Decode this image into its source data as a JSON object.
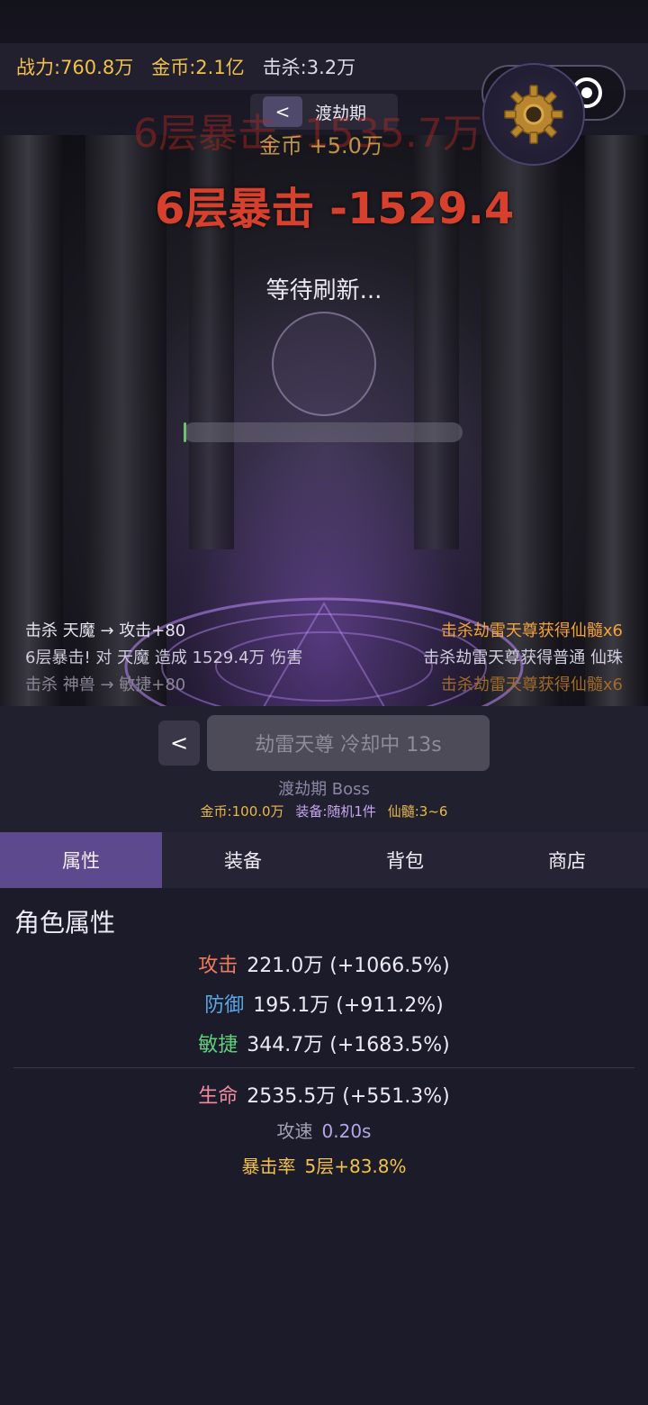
{
  "stats": {
    "power": "战力:760.8万",
    "gold": "金币:2.1亿",
    "kills": "击杀:3.2万"
  },
  "stage": {
    "back_label": "<",
    "name": "渡劫期"
  },
  "battle": {
    "ghost_damage": "6层暴击 -1535.7万",
    "damage_text": "6层暴击 -1529.4万",
    "gold_float": "金币 +5.0万",
    "wait_text": "等待刷新...",
    "progress_fraction": 0.01
  },
  "log": {
    "left": [
      {
        "text": "击杀 天魔 → 攻击+80",
        "color": "#e6e2ee"
      },
      {
        "text": "6层暴击! 对 天魔 造成 1529.4万 伤害",
        "color": "#cfc9dc"
      },
      {
        "text": "击杀 神兽 → 敏捷+80",
        "color": "#8a8596"
      }
    ],
    "right": [
      {
        "text": "击杀劫雷天尊获得仙髓x6",
        "color": "#f2a33a"
      },
      {
        "text": "击杀劫雷天尊获得普通 仙珠",
        "color": "#d3cedf"
      },
      {
        "text": "击杀劫雷天尊获得仙髓x6",
        "color": "#a06a2a"
      }
    ]
  },
  "boss": {
    "back_label": "<",
    "button_label": "劫雷天尊 冷却中 13s",
    "label": "渡劫期 Boss",
    "rewards": {
      "gold": "金币:100.0万",
      "equip": "装备:随机1件",
      "marrow": "仙髓:3~6"
    }
  },
  "tabs": [
    "属性",
    "装备",
    "背包",
    "商店"
  ],
  "active_tab": "属性",
  "attributes": {
    "title": "角色属性",
    "attack": {
      "label": "攻击",
      "value": "221.0万 (+1066.5%)",
      "color": "#f07a5e"
    },
    "defense": {
      "label": "防御",
      "value": "195.1万 (+911.2%)",
      "color": "#5aa8e6"
    },
    "agility": {
      "label": "敏捷",
      "value": "344.7万 (+1683.5%)",
      "color": "#5fcf7a"
    },
    "hp": {
      "label": "生命",
      "value": "2535.5万 (+551.3%)",
      "color": "#f08aa0"
    },
    "speed": {
      "label": "攻速",
      "value": "0.20s",
      "color": "#b4a6e8"
    },
    "crit": {
      "label": "暴击率",
      "value": "5层+83.8%",
      "color": "#f2c14a"
    }
  },
  "colors": {
    "gold": "#f2c14a",
    "accent": "#5d4a8e",
    "panel": "#1c1b2a"
  },
  "icons": [
    "more-dots-icon",
    "target-icon",
    "gear-icon"
  ]
}
